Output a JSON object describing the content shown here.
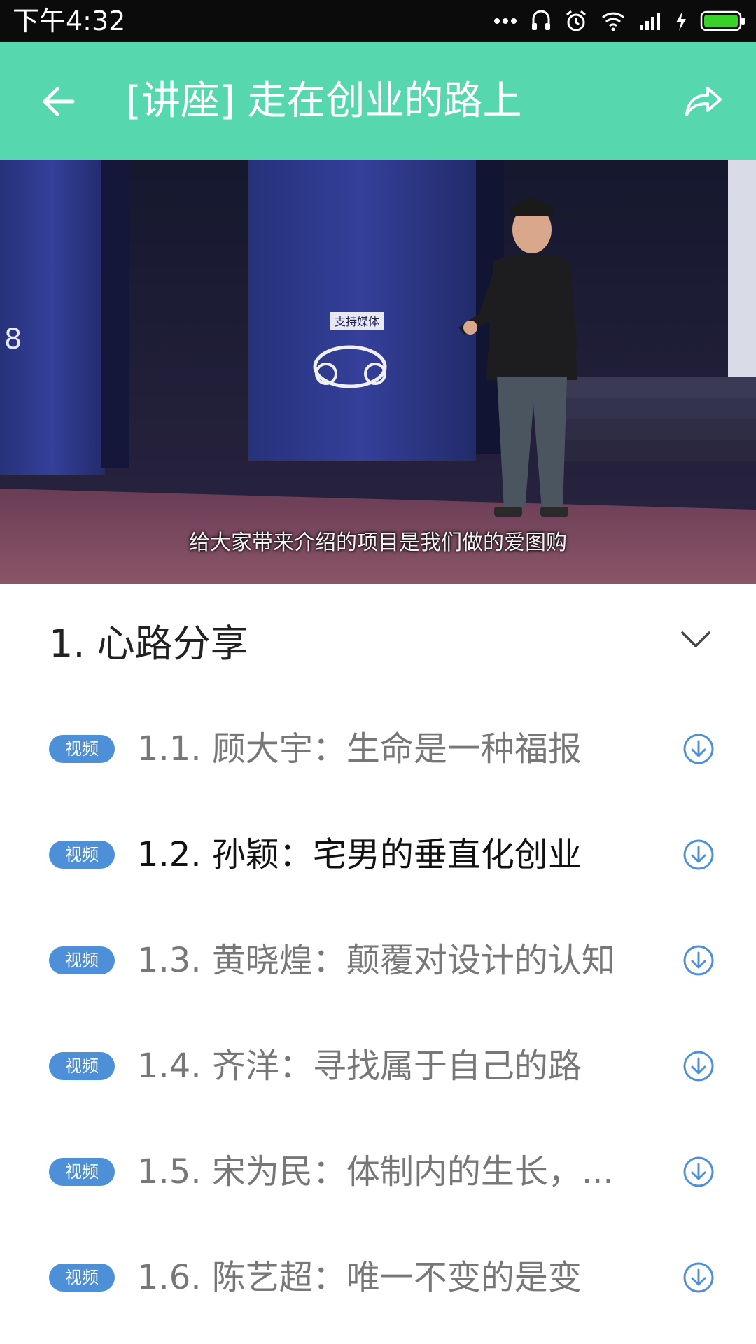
{
  "status_bar": {
    "time": "下午4:32",
    "icons": [
      "more-icon",
      "headset-icon",
      "alarm-icon",
      "wifi-icon",
      "signal-icon",
      "charging-icon",
      "battery-icon"
    ]
  },
  "app_bar": {
    "title": "[讲座] 走在创业的路上",
    "back_icon": "back-arrow-icon",
    "share_icon": "share-icon",
    "color": "#56d7ad"
  },
  "video": {
    "subtitle": "给大家带来介绍的项目是我们做的爱图购",
    "stage_number": "8",
    "banner_text": "支持媒体"
  },
  "chapter": {
    "title": "1. 心路分享",
    "toggle_icon": "chevron-down-icon"
  },
  "lessons": [
    {
      "badge": "视频",
      "title": "1.1. 顾大宇：生命是一种福报",
      "active": false
    },
    {
      "badge": "视频",
      "title": "1.2. 孙颖：宅男的垂直化创业",
      "active": true
    },
    {
      "badge": "视频",
      "title": "1.3. 黄晓煌：颠覆对设计的认知",
      "active": false
    },
    {
      "badge": "视频",
      "title": "1.4. 齐洋：寻找属于自己的路",
      "active": false
    },
    {
      "badge": "视频",
      "title": "1.5. 宋为民：体制内的生长，...",
      "active": false
    },
    {
      "badge": "视频",
      "title": "1.6. 陈艺超：唯一不变的是变",
      "active": false
    }
  ],
  "colors": {
    "badge": "#4e90d8",
    "download_icon": "#4e90d8",
    "active_text": "#111111",
    "inactive_text": "#777777"
  }
}
